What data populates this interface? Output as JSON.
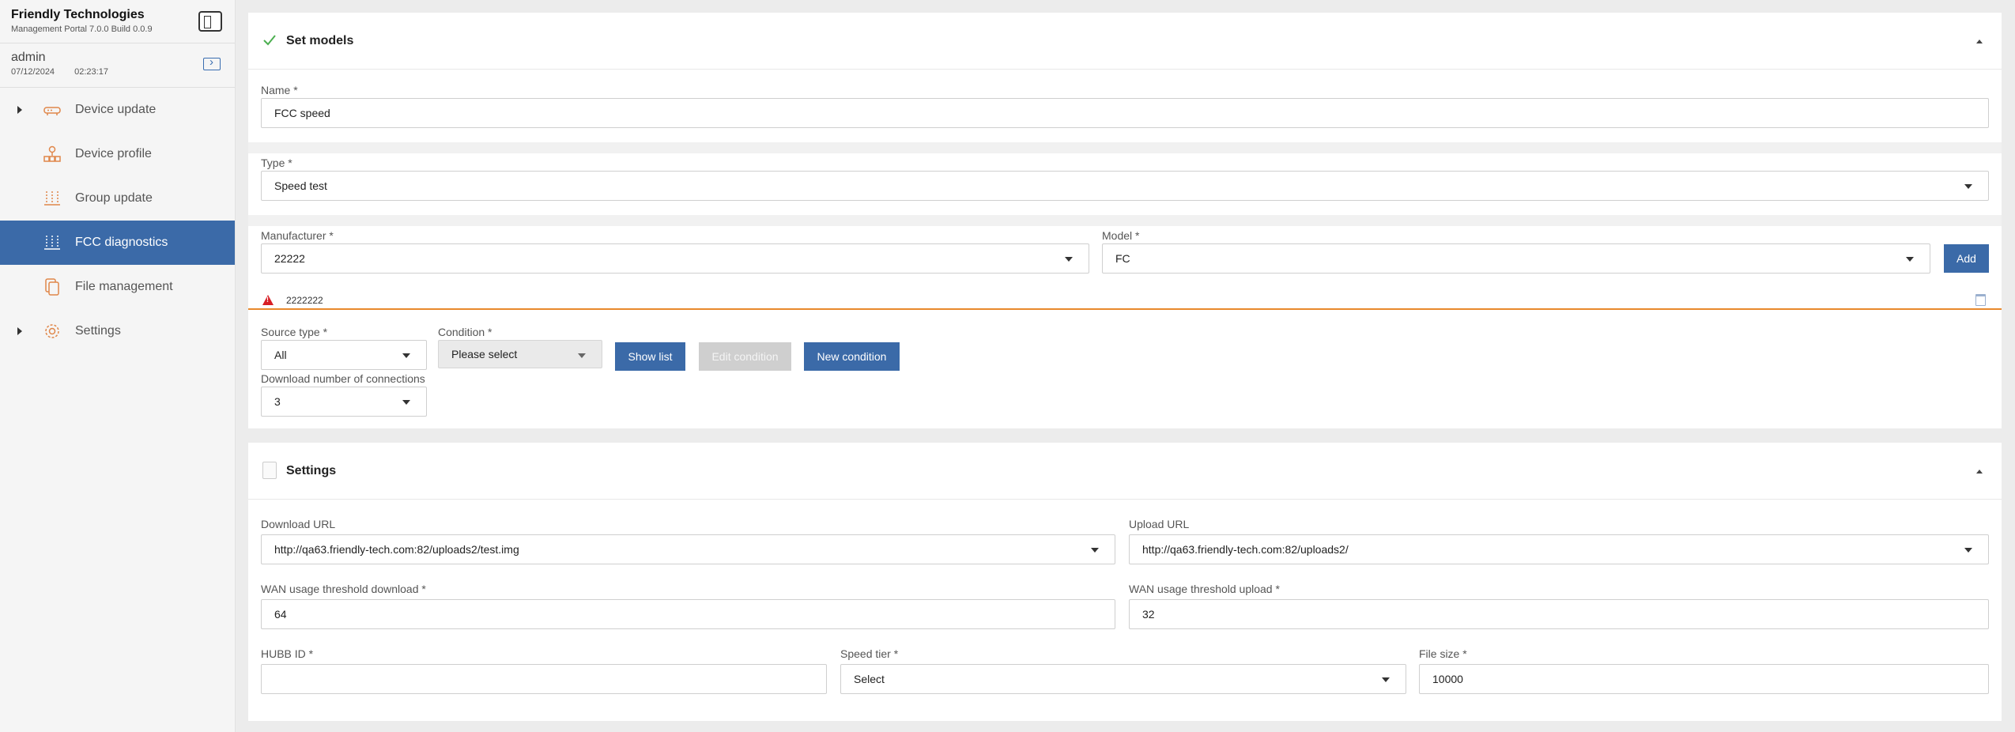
{
  "brand": {
    "title": "Friendly Technologies",
    "subtitle": "Management Portal 7.0.0 Build 0.0.9"
  },
  "user": {
    "name": "admin",
    "date": "07/12/2024",
    "time": "02:23:17"
  },
  "nav": {
    "items": [
      {
        "label": "Device update",
        "expandable": true,
        "active": false,
        "icon": "router-icon"
      },
      {
        "label": "Device profile",
        "expandable": false,
        "active": false,
        "icon": "profile-tree-icon"
      },
      {
        "label": "Group update",
        "expandable": false,
        "active": false,
        "icon": "sliders-icon"
      },
      {
        "label": "FCC diagnostics",
        "expandable": false,
        "active": true,
        "icon": "sliders-icon"
      },
      {
        "label": "File management",
        "expandable": false,
        "active": false,
        "icon": "files-icon"
      },
      {
        "label": "Settings",
        "expandable": true,
        "active": false,
        "icon": "gear-icon"
      }
    ]
  },
  "set_models": {
    "title": "Set models",
    "name_label": "Name *",
    "name_value": "FCC speed",
    "type_label": "Type *",
    "type_value": "Speed test",
    "manufacturer_label": "Manufacturer *",
    "manufacturer_value": "22222",
    "model_label": "Model *",
    "model_value": "FC",
    "add_label": "Add",
    "model_entry": "2222222",
    "source_type_label": "Source type *",
    "source_type_value": "All",
    "condition_label": "Condition *",
    "condition_value": "Please select",
    "show_list_label": "Show list",
    "edit_condition_label": "Edit condition",
    "new_condition_label": "New condition",
    "connections_label": "Download number of connections",
    "connections_value": "3"
  },
  "settings": {
    "title": "Settings",
    "download_url_label": "Download URL",
    "download_url_value": "http://qa63.friendly-tech.com:82/uploads2/test.img",
    "upload_url_label": "Upload URL",
    "upload_url_value": "http://qa63.friendly-tech.com:82/uploads2/",
    "wan_download_label": "WAN usage threshold download *",
    "wan_download_value": "64",
    "wan_upload_label": "WAN usage threshold upload *",
    "wan_upload_value": "32",
    "hubb_label": "HUBB ID *",
    "hubb_value": "",
    "speed_tier_label": "Speed tier *",
    "speed_tier_value": "Select",
    "file_size_label": "File size *",
    "file_size_value": "10000"
  },
  "colors": {
    "accent": "#3b6aa8",
    "icon_orange": "#e0874a",
    "warning_red": "#d81f26",
    "warning_line": "#e8892c",
    "success_green": "#4caf50"
  }
}
